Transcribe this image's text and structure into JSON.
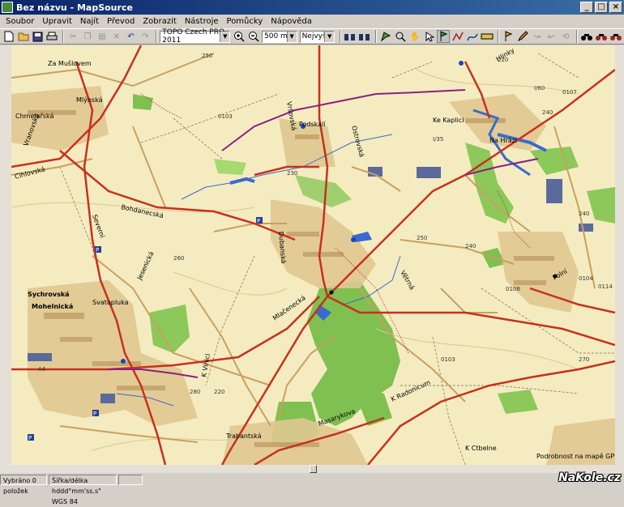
{
  "window": {
    "title": "Bez názvu - MapSource"
  },
  "menu": [
    "Soubor",
    "Upravit",
    "Najít",
    "Převod",
    "Zobrazit",
    "Nástroje",
    "Pomůcky",
    "Nápověda"
  ],
  "toolbar": {
    "map_product": "TOPO Czech PRO 2011",
    "scale": "500 m",
    "detail": "Nejvyšší"
  },
  "status": {
    "selection": "Vybráno 0 položek",
    "coord_format": "Šířka/délka hddd°mm'ss.s\"",
    "datum": "WGS 84"
  },
  "map": {
    "footnote": "Podrobnost na mapě GPS",
    "labels": [
      {
        "text": "Za Mušlovem"
      },
      {
        "text": "Chmelařská"
      },
      {
        "text": "Mlýnská"
      },
      {
        "text": "Vranovská"
      },
      {
        "text": "Cihlovská"
      },
      {
        "text": "Severní"
      },
      {
        "text": "Bohdanecská"
      },
      {
        "text": "Jesenická"
      },
      {
        "text": "Sychrovská"
      },
      {
        "text": "Mohelnická"
      },
      {
        "text": "Svatopluka"
      },
      {
        "text": "Trabantská"
      },
      {
        "text": "Podskalí"
      },
      {
        "text": "Ostrovská"
      },
      {
        "text": "Vršovská"
      },
      {
        "text": "Dubanská"
      },
      {
        "text": "Mlačenecká"
      },
      {
        "text": "K Vinici"
      },
      {
        "text": "Masarykova"
      },
      {
        "text": "Ke Kaplici"
      },
      {
        "text": "Hlinky"
      },
      {
        "text": "Na Hrázi"
      },
      {
        "text": "Větrná"
      },
      {
        "text": "K Radonicum"
      },
      {
        "text": "K Ctbelne"
      },
      {
        "text": "Polní"
      }
    ],
    "road_numbers": [
      "0103",
      "0104",
      "0107",
      "0108",
      "0114",
      "0105",
      "I/35",
      "I/60",
      "A4"
    ],
    "contours": [
      "250",
      "240",
      "260",
      "230",
      "270",
      "220",
      "280"
    ]
  },
  "watermark": "NaKole.cz"
}
